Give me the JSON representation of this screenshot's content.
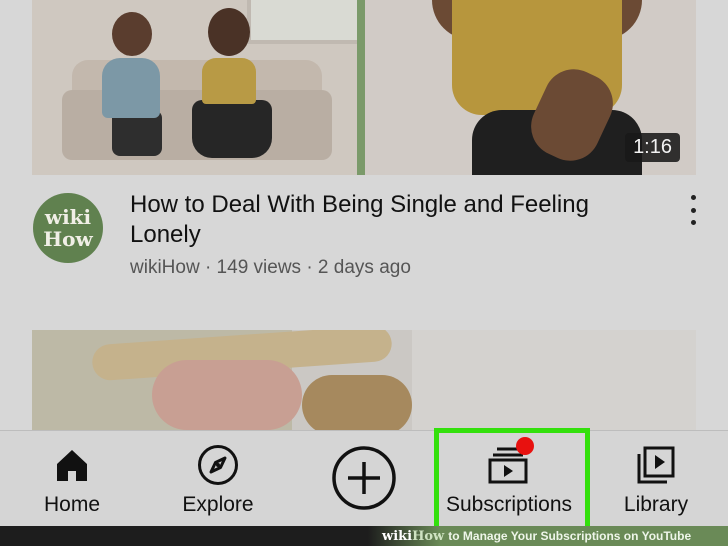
{
  "video": {
    "duration": "1:16",
    "channel_avatar_line1": "wiki",
    "channel_avatar_line2": "How",
    "title": "How to Deal With Being Single and Feeling Lonely",
    "meta": "wikiHow · 149 views · 2 days ago"
  },
  "bottom_nav": {
    "home": "Home",
    "explore": "Explore",
    "subscriptions": "Subscriptions",
    "library": "Library"
  },
  "footer": {
    "brand_a": "wiki",
    "brand_b": "How",
    "caption": "to Manage Your Subscriptions on YouTube"
  },
  "colors": {
    "highlight": "#33e00c",
    "notification": "#e8110f",
    "avatar_bg": "#60814f"
  }
}
